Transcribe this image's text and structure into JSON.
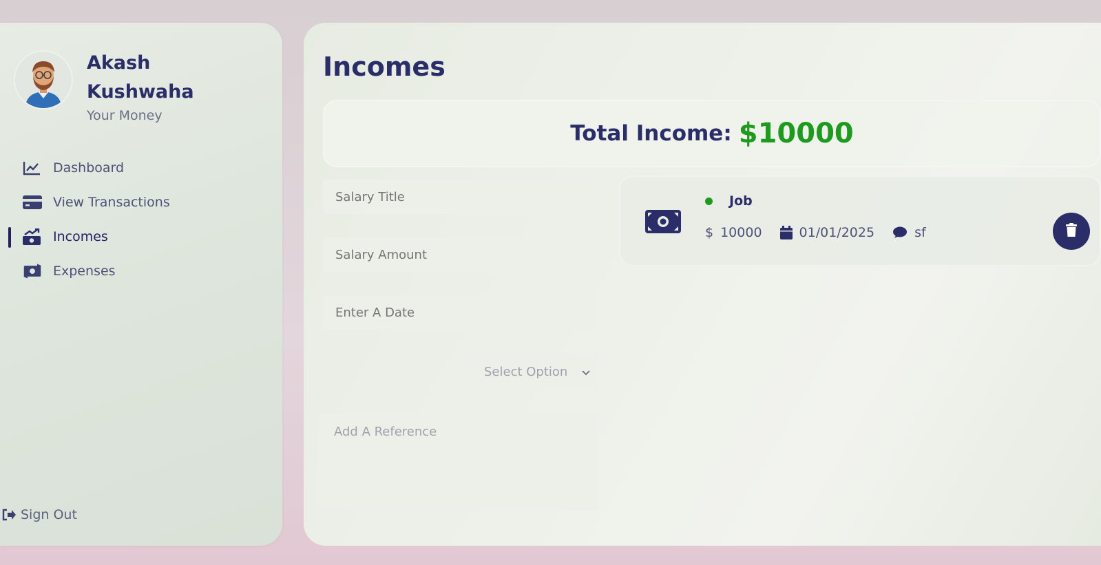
{
  "sidebar": {
    "user_name": "Akash Kushwaha",
    "user_subtitle": "Your Money",
    "items": [
      {
        "label": "Dashboard",
        "icon": "line-chart-icon"
      },
      {
        "label": "View Transactions",
        "icon": "credit-card-icon"
      },
      {
        "label": "Incomes",
        "icon": "money-bill-trend-icon"
      },
      {
        "label": "Expenses",
        "icon": "money-bill-transfer-icon"
      }
    ],
    "active_item": "Incomes",
    "sign_out_label": "Sign Out"
  },
  "main": {
    "title": "Incomes",
    "total_label": "Total Income:",
    "total_value": "$10000",
    "form": {
      "title_placeholder": "Salary Title",
      "amount_placeholder": "Salary Amount",
      "date_placeholder": "Enter A Date",
      "select_placeholder": "Select Option",
      "reference_placeholder": "Add A Reference"
    },
    "incomes": [
      {
        "title": "Job",
        "currency_symbol": "$",
        "amount": "10000",
        "date": "01/01/2025",
        "reference": "sf"
      }
    ]
  },
  "colors": {
    "primary": "#222260",
    "income_green": "#1e9a1e",
    "card_bg": "#e7ece3"
  }
}
